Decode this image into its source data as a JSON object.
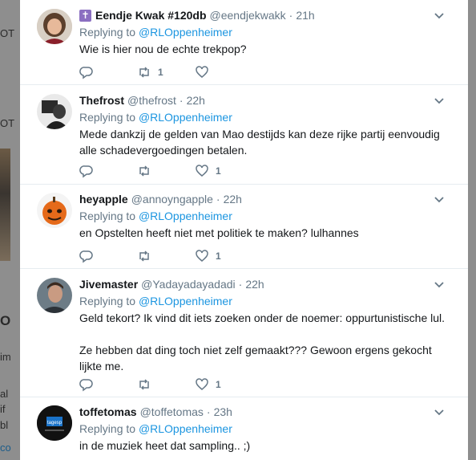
{
  "background": {
    "fragments": [
      "OT",
      "OT",
      "O",
      "im",
      "",
      "al",
      "if",
      "bl",
      "co"
    ]
  },
  "replying_prefix": "Replying to",
  "tweets": [
    {
      "name": "Eendje Kwak #120db",
      "handle": "@eendjekwakk",
      "time": "21h",
      "badge": "latin-cross-icon",
      "replying_to": "@RLOppenheimer",
      "text": [
        "Wie is hier nou de echte trekpop?"
      ],
      "retweets": "1",
      "likes": ""
    },
    {
      "name": "Thefrost",
      "handle": "@thefrost",
      "time": "22h",
      "replying_to": "@RLOppenheimer",
      "text": [
        "Mede dankzij de gelden van Mao destijds kan deze rijke partij eenvoudig alle schadevergoedingen betalen."
      ],
      "retweets": "",
      "likes": "1"
    },
    {
      "name": "heyapple",
      "handle": "@annoyngapple",
      "time": "22h",
      "replying_to": "@RLOppenheimer",
      "text": [
        "en Opstelten heeft niet met politiek te maken? lulhannes"
      ],
      "retweets": "",
      "likes": "1"
    },
    {
      "name": "Jivemaster",
      "handle": "@Yadayadayadadi",
      "time": "22h",
      "replying_to": "@RLOppenheimer",
      "text": [
        "Geld tekort? Ik vind dit iets zoeken onder de noemer: oppurtunistische lul.",
        "Ze hebben dat ding toch niet zelf gemaakt??? Gewoon ergens gekocht lijkte me."
      ],
      "retweets": "",
      "likes": "1"
    },
    {
      "name": "toffetomas",
      "handle": "@toffetomas",
      "time": "23h",
      "replying_to": "@RLOppenheimer",
      "avatar_text": "tagesp",
      "text": [
        "in de muziek heet dat sampling.. ;)"
      ],
      "retweets": "",
      "likes": ""
    }
  ],
  "colors": {
    "link": "#1b95e0",
    "secondary": "#657786",
    "text": "#14171a",
    "divider": "#e6ecf0",
    "overlay": "#8f8f8f"
  }
}
